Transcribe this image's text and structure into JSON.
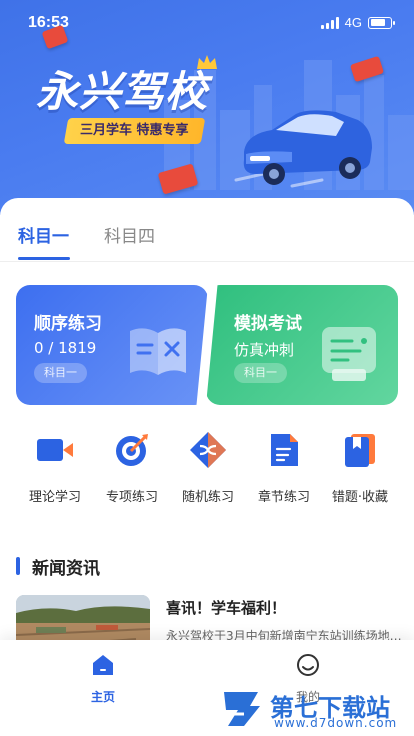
{
  "status_bar": {
    "time": "16:53",
    "network": "4G"
  },
  "banner": {
    "brand": "永兴驾校",
    "slogan": "三月学车  特惠专享",
    "colors": {
      "primary": "#3f72e8",
      "slogan_bg": "#ffc23a"
    }
  },
  "tabs": [
    {
      "label": "科目一",
      "active": true
    },
    {
      "label": "科目四",
      "active": false
    }
  ],
  "cards": {
    "sequence": {
      "title": "顺序练习",
      "progress": "0 / 1819",
      "tag": "科目一",
      "icon": "book-icon",
      "color": "#3d6ff0"
    },
    "mock": {
      "title": "模拟考试",
      "subtitle": "仿真冲刺",
      "tag": "科目一",
      "icon": "exam-board-icon",
      "color": "#2fbf7e"
    }
  },
  "functions": [
    {
      "label": "理论学习",
      "icon": "video-camera-icon"
    },
    {
      "label": "专项练习",
      "icon": "target-icon"
    },
    {
      "label": "随机练习",
      "icon": "shuffle-icon"
    },
    {
      "label": "章节练习",
      "icon": "document-icon"
    },
    {
      "label": "错题·收藏",
      "icon": "bookmark-book-icon"
    }
  ],
  "news": {
    "section_title": "新闻资讯",
    "items": [
      {
        "headline": "喜讯！学车福利！",
        "summary": "永兴驾校于3月中旬新增南宁东站训练场地…"
      }
    ]
  },
  "bottom_nav": {
    "home": {
      "label": "主页",
      "active": true,
      "icon": "home-icon"
    },
    "mine": {
      "label": "我的",
      "active": false,
      "icon": "user-icon"
    }
  },
  "watermark": {
    "text": "第七下载站",
    "url": "www.d7down.com"
  }
}
